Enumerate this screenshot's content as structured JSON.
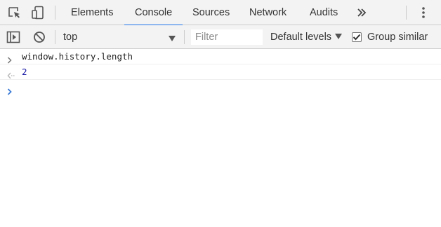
{
  "tabs": [
    {
      "label": "Elements",
      "active": false
    },
    {
      "label": "Console",
      "active": true
    },
    {
      "label": "Sources",
      "active": false
    },
    {
      "label": "Network",
      "active": false
    },
    {
      "label": "Audits",
      "active": false
    }
  ],
  "more_tabs_icon": "chevron-double-right-icon",
  "toolbar": {
    "context": "top",
    "filter_placeholder": "Filter",
    "levels_label": "Default levels",
    "group_similar_label": "Group similar",
    "group_similar_checked": true
  },
  "console": {
    "input": "window.history.length",
    "result": "2"
  },
  "colors": {
    "accent": "#1a73e8",
    "result_number": "#1a1aa6",
    "prompt": "#3c7bd6"
  }
}
